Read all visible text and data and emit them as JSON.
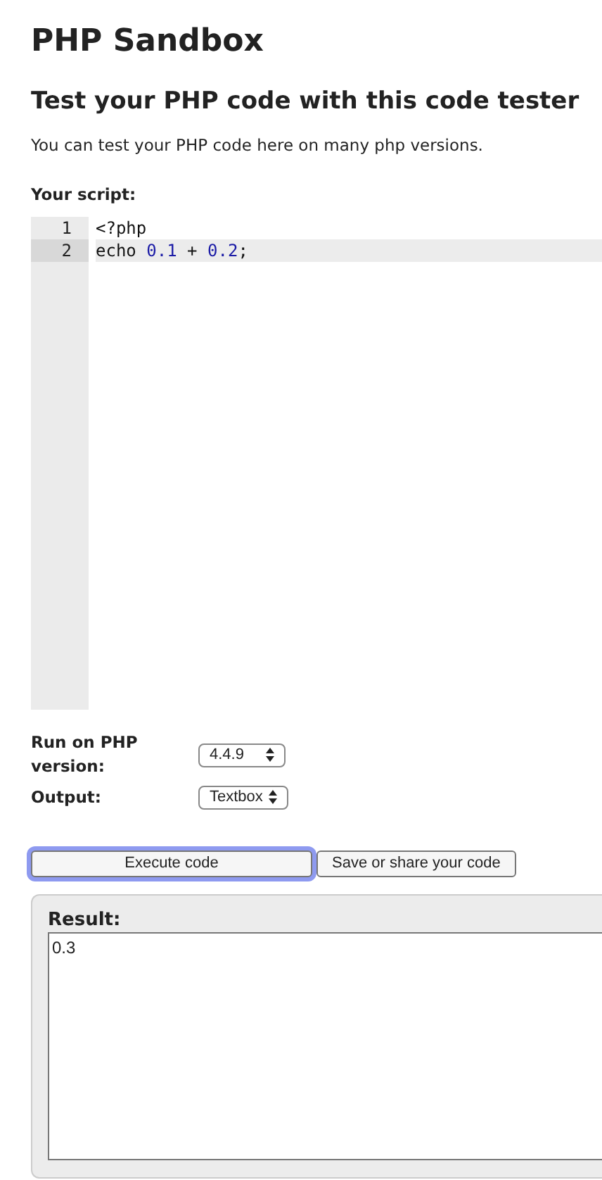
{
  "title": "PHP Sandbox",
  "subtitle": "Test your PHP code with this code tester",
  "intro": "You can test your PHP code here on many php versions.",
  "script_label": "Your script:",
  "editor": {
    "lines": [
      {
        "number": "1",
        "selected": false,
        "tokens": [
          {
            "text": "<?php",
            "kind": "plain"
          }
        ]
      },
      {
        "number": "2",
        "selected": true,
        "tokens": [
          {
            "text": "echo ",
            "kind": "plain"
          },
          {
            "text": "0.1",
            "kind": "number"
          },
          {
            "text": " + ",
            "kind": "plain"
          },
          {
            "text": "0.2",
            "kind": "number"
          },
          {
            "text": ";",
            "kind": "plain"
          }
        ]
      }
    ]
  },
  "options": [
    {
      "label": "Run on PHP version:",
      "value": "4.4.9"
    },
    {
      "label": "Output:",
      "value": "Textbox"
    }
  ],
  "buttons": [
    {
      "label": "Execute code",
      "focused": true
    },
    {
      "label": "Save or share your code",
      "focused": false
    }
  ],
  "result": {
    "label": "Result:",
    "value": "0.3"
  }
}
